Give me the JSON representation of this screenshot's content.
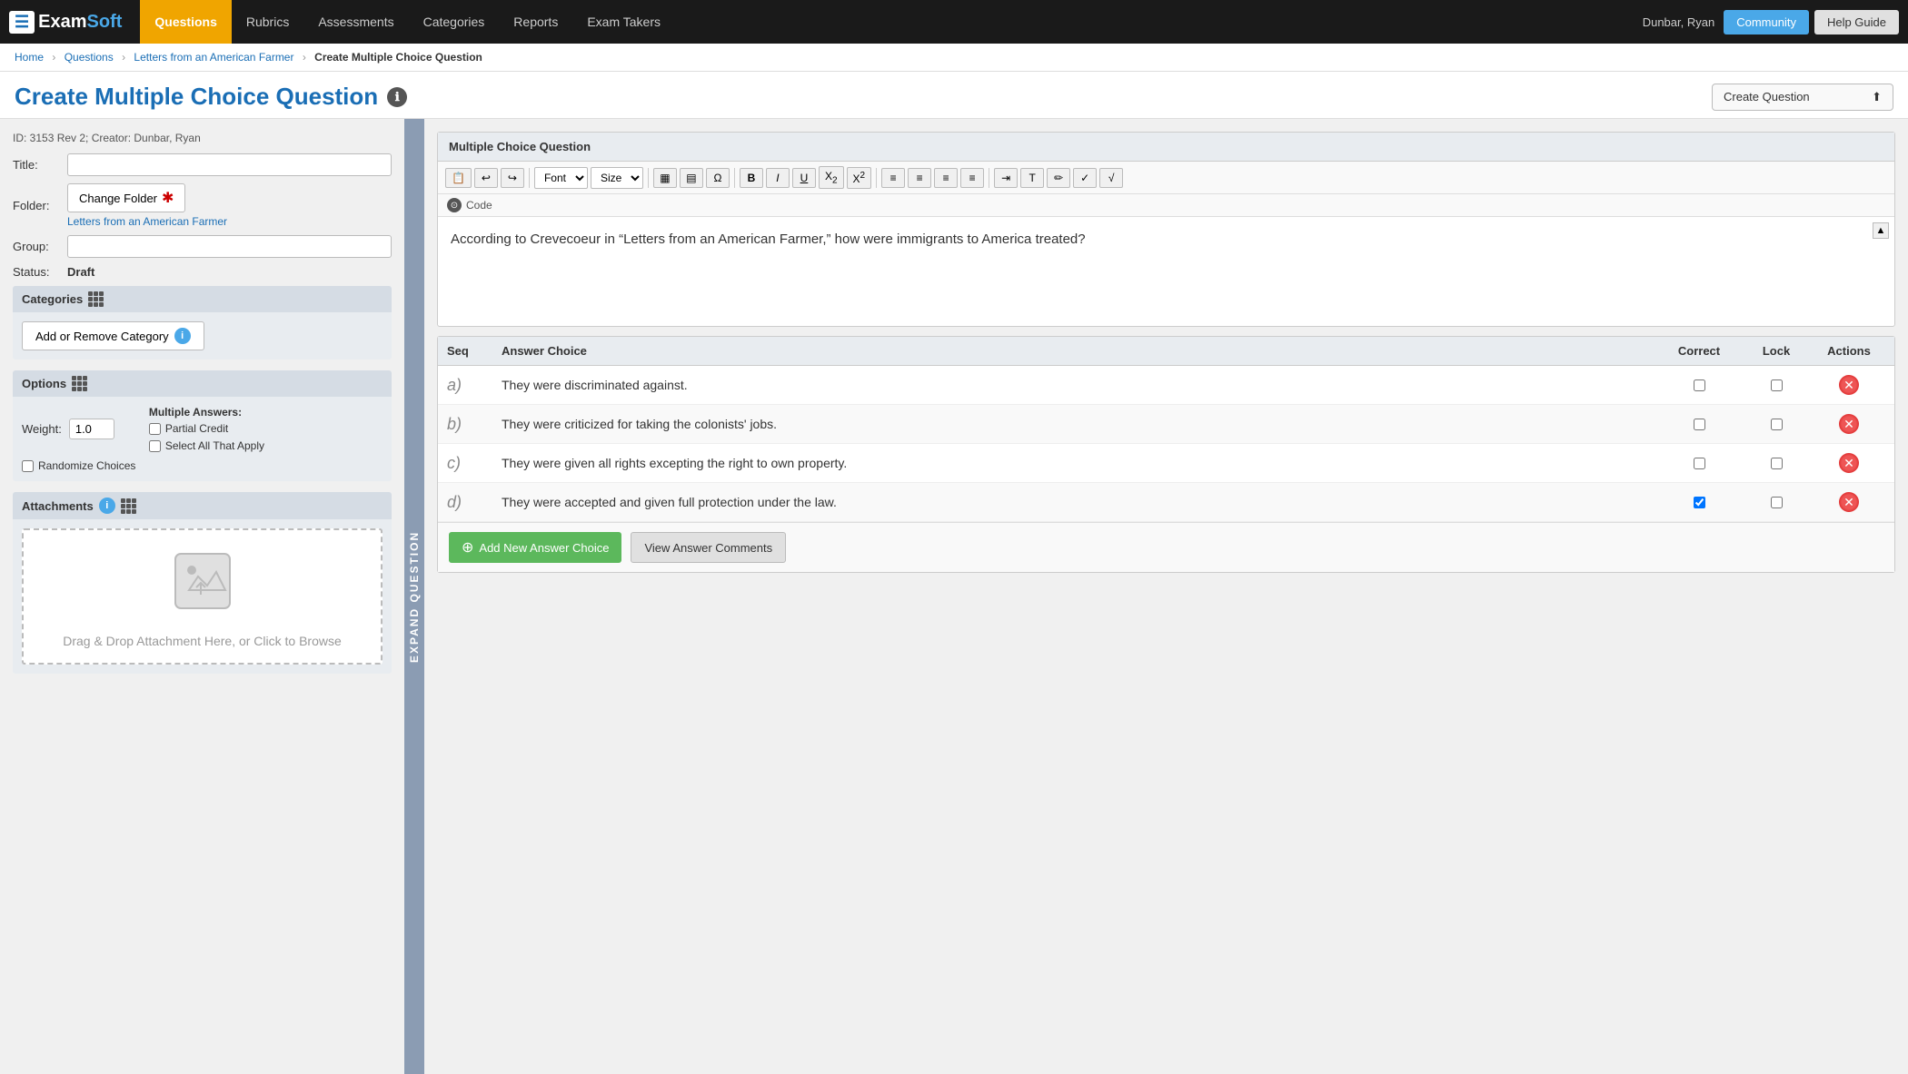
{
  "nav": {
    "logo_exam": "Exam",
    "logo_soft": "Soft",
    "links": [
      {
        "label": "Questions",
        "active": true
      },
      {
        "label": "Rubrics",
        "active": false
      },
      {
        "label": "Assessments",
        "active": false
      },
      {
        "label": "Categories",
        "active": false
      },
      {
        "label": "Reports",
        "active": false
      },
      {
        "label": "Exam Takers",
        "active": false
      }
    ],
    "user": "Dunbar, Ryan",
    "community_label": "Community",
    "help_label": "Help Guide"
  },
  "breadcrumb": {
    "items": [
      "Home",
      "Questions",
      "Letters from an American Farmer"
    ],
    "current": "Create Multiple Choice Question"
  },
  "page": {
    "title": "Create Multiple Choice Question",
    "info_symbol": "ℹ",
    "id_info": "ID: 3153 Rev 2; Creator: Dunbar, Ryan",
    "create_question_dropdown": "Create Question"
  },
  "form": {
    "title_label": "Title:",
    "title_value": "",
    "folder_label": "Folder:",
    "folder_button": "Change Folder",
    "folder_link": "Letters from an American Farmer",
    "group_label": "Group:",
    "group_value": "",
    "status_label": "Status:",
    "status_value": "Draft"
  },
  "categories": {
    "header": "Categories",
    "button_label": "Add or Remove Category"
  },
  "options": {
    "header": "Options",
    "weight_label": "Weight:",
    "weight_value": "1.0",
    "multiple_answers_label": "Multiple Answers:",
    "partial_credit_label": "Partial Credit",
    "select_all_label": "Select All That Apply",
    "randomize_label": "Randomize Choices"
  },
  "attachments": {
    "header": "Attachments",
    "drop_text": "Drag & Drop Attachment Here, or Click to Browse"
  },
  "expand_tab": "EXPAND QUESTION",
  "editor": {
    "header": "Multiple Choice Question",
    "code_label": "Code",
    "font_label": "Font",
    "size_label": "Size",
    "question_text": "According to Crevecoeur in “Letters from an American Farmer,” how were immigrants to America treated?",
    "toolbar_buttons": [
      "📋",
      "↩",
      "↪",
      "B",
      "I",
      "U",
      "X₂",
      "X²",
      "≡",
      "≡",
      "≡",
      "≡",
      "T"
    ]
  },
  "answer_table": {
    "columns": [
      "Seq",
      "Answer Choice",
      "Correct",
      "Lock",
      "Actions"
    ],
    "rows": [
      {
        "seq": "a)",
        "text": "They were discriminated against.",
        "correct": false,
        "lock": false
      },
      {
        "seq": "b)",
        "text": "They were criticized for taking the colonists' jobs.",
        "correct": false,
        "lock": false
      },
      {
        "seq": "c)",
        "text": "They were given all rights excepting the right to own property.",
        "correct": false,
        "lock": false
      },
      {
        "seq": "d)",
        "text": "They were accepted and given full protection under the law.",
        "correct": true,
        "lock": false
      }
    ],
    "add_button": "Add New Answer Choice",
    "comments_button": "View Answer Comments"
  }
}
